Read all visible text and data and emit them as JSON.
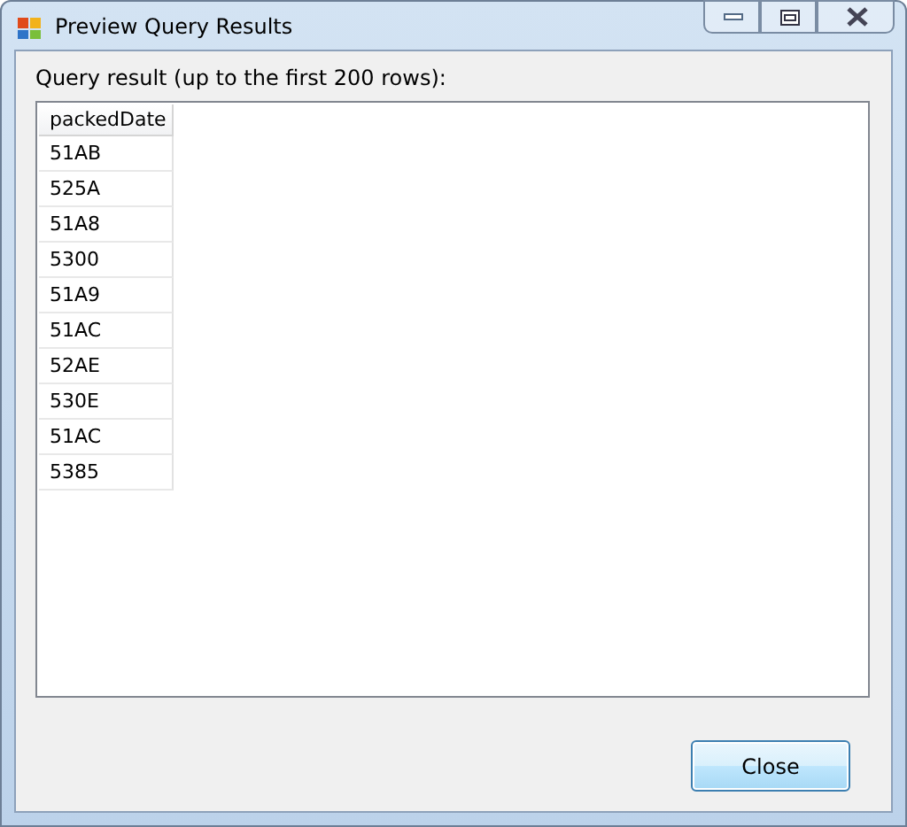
{
  "window": {
    "title": "Preview Query Results"
  },
  "label": "Query result (up to the first 200 rows):",
  "table": {
    "columns": [
      "packedDate"
    ],
    "rows": [
      [
        "51AB"
      ],
      [
        "525A"
      ],
      [
        "51A8"
      ],
      [
        "5300"
      ],
      [
        "51A9"
      ],
      [
        "51AC"
      ],
      [
        "52AE"
      ],
      [
        "530E"
      ],
      [
        "51AC"
      ],
      [
        "5385"
      ]
    ]
  },
  "buttons": [
    "Close"
  ]
}
